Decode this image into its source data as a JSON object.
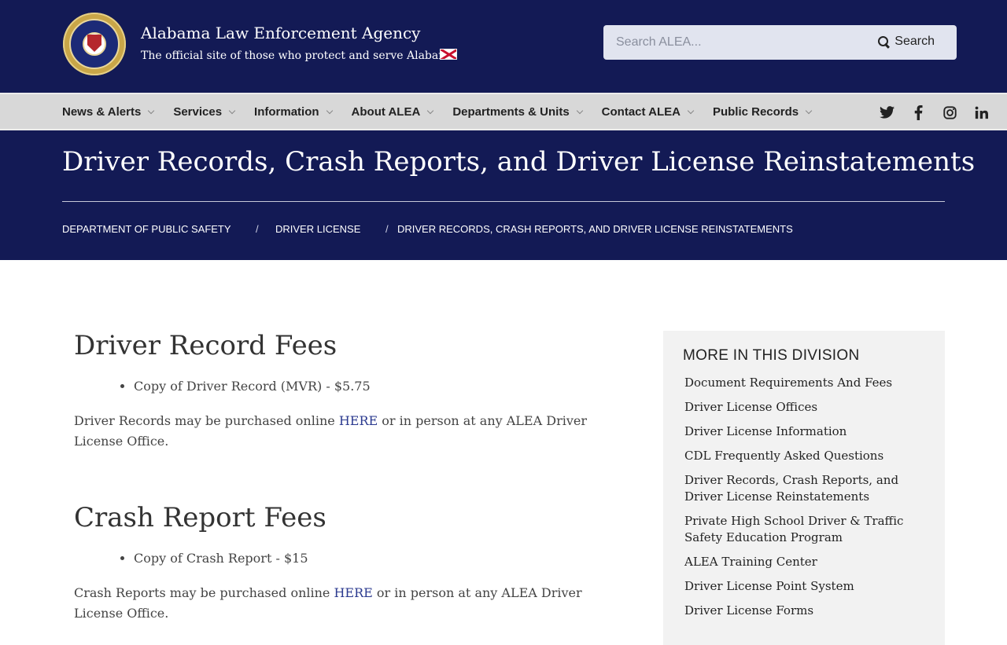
{
  "header": {
    "title": "Alabama Law Enforcement Agency",
    "subtitle": "The official site of those who protect and serve Alabama",
    "search_placeholder": "Search ALEA...",
    "search_button": "Search"
  },
  "nav": {
    "items": [
      "News & Alerts",
      "Services",
      "Information",
      "About ALEA",
      "Departments & Units",
      "Contact ALEA",
      "Public Records"
    ],
    "social": [
      "twitter-icon",
      "facebook-icon",
      "instagram-icon",
      "linkedin-icon"
    ]
  },
  "hero": {
    "title": "Driver Records, Crash Reports, and Driver License Reinstatements",
    "breadcrumbs": [
      "DEPARTMENT OF PUBLIC SAFETY",
      "DRIVER LICENSE",
      "DRIVER RECORDS, CRASH REPORTS, AND DRIVER LICENSE REINSTATEMENTS"
    ],
    "separator": "/"
  },
  "content": {
    "section1": {
      "heading": "Driver Record Fees",
      "bullet": "Copy of Driver Record (MVR) - $5.75",
      "text_before": "Driver Records may be purchased online ",
      "link": "HERE",
      "text_after": " or in person at any ALEA Driver License Office."
    },
    "section2": {
      "heading": "Crash Report Fees",
      "bullet": "Copy of Crash Report - $15",
      "text_before": "Crash Reports may be purchased online ",
      "link": "HERE",
      "text_after": " or in person at any ALEA Driver License Office."
    }
  },
  "sidebar": {
    "heading": "MORE IN THIS DIVISION",
    "links": [
      "Document Requirements And Fees",
      "Driver License Offices",
      "Driver License Information",
      "CDL Frequently Asked Questions",
      "Driver Records, Crash Reports, and Driver License Reinstatements",
      "Private High School Driver & Traffic Safety Education Program",
      "ALEA Training Center",
      "Driver License Point System",
      "Driver License Forms"
    ]
  },
  "colors": {
    "navy": "#131a55",
    "nav_bg": "#d8d8d8",
    "link": "#2b3a8f",
    "sidebar_bg": "#f2f2f2"
  }
}
